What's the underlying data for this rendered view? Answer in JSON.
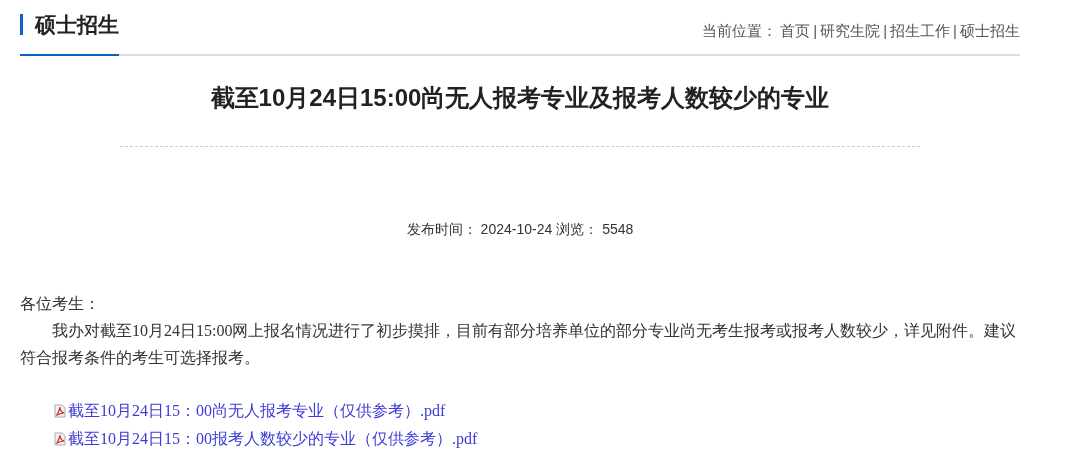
{
  "section": {
    "title": "硕士招生"
  },
  "breadcrumb": {
    "label": "当前位置：",
    "separator": "|",
    "items": [
      "首页",
      "研究生院",
      "招生工作",
      "硕士招生"
    ]
  },
  "article": {
    "title": "截至10月24日15:00尚无人报考专业及报考人数较少的专业",
    "meta": {
      "published_label": "发布时间：",
      "published": "2024-10-24",
      "views_label": "浏览：",
      "views": "5548"
    },
    "greeting": "各位考生：",
    "body": "我办对截至10月24日15:00网上报名情况进行了初步摸排，目前有部分培养单位的部分专业尚无考生报考或报考人数较少，详见附件。建议符合报考条件的考生可选择报考。",
    "attachments": [
      "截至10月24日15：00尚无人报考专业（仅供参考）.pdf",
      "截至10月24日15：00报考人数较少的专业（仅供参考）.pdf"
    ]
  }
}
